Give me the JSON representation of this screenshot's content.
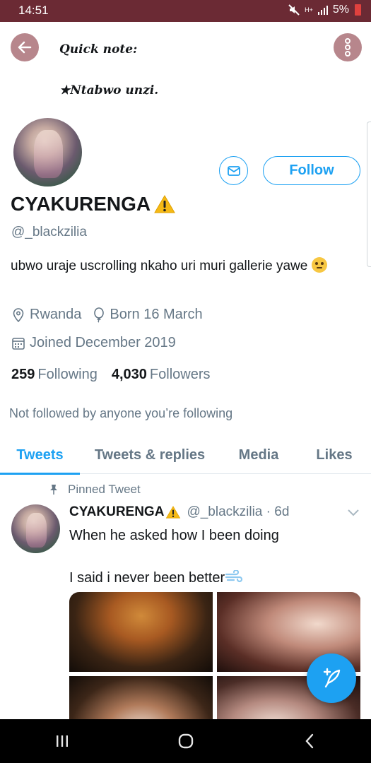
{
  "status_bar": {
    "time": "14:51",
    "battery": "5%",
    "signal_label": "H+"
  },
  "header": {
    "note_line1": "Quick note:",
    "note_line2": "★Ntabwo unzi."
  },
  "profile": {
    "display_name": "CYAKURENGA",
    "handle": "@_blackzilia",
    "bio": "ubwo uraje uscrolling nkaho uri muri gallerie yawe",
    "location": "Rwanda",
    "birthday": "Born 16 March",
    "joined": "Joined December 2019",
    "following_count": "259",
    "following_label": "Following",
    "followers_count": "4,030",
    "followers_label": "Followers",
    "not_followed_text": "Not followed by anyone you’re following",
    "follow_button": "Follow"
  },
  "tabs": [
    {
      "label": "Tweets",
      "active": true
    },
    {
      "label": "Tweets & replies",
      "active": false
    },
    {
      "label": "Media",
      "active": false
    },
    {
      "label": "Likes",
      "active": false
    }
  ],
  "tweet": {
    "pinned_label": "Pinned Tweet",
    "name": "CYAKURENGA",
    "handle_time": "@_blackzilia · 6d",
    "text": "When he asked how I been doing\n\nI said i never been better"
  },
  "colors": {
    "accent": "#1da1f2",
    "status_bar": "#6b2a34",
    "header_button": "#b7868c",
    "secondary_text": "#657786"
  },
  "icons": {
    "back": "arrow-left-icon",
    "more": "vertical-dots-icon",
    "message": "envelope-icon",
    "location": "map-pin-icon",
    "birthday": "balloon-icon",
    "joined": "calendar-icon",
    "pin": "pin-icon",
    "compose": "feather-plus-icon"
  }
}
